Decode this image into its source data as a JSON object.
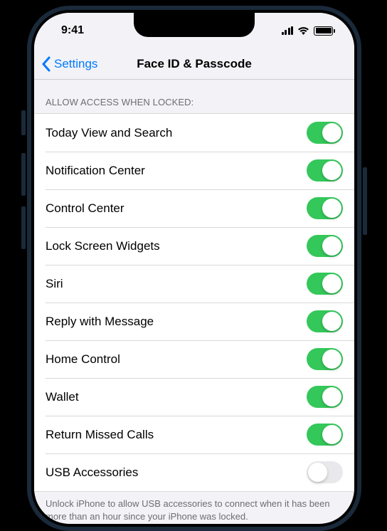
{
  "status": {
    "time": "9:41"
  },
  "nav": {
    "back_label": "Settings",
    "title": "Face ID & Passcode"
  },
  "section": {
    "header": "ALLOW ACCESS WHEN LOCKED:",
    "footer": "Unlock iPhone to allow USB accessories to connect when it has been more than an hour since your iPhone was locked."
  },
  "rows": [
    {
      "label": "Today View and Search",
      "on": true
    },
    {
      "label": "Notification Center",
      "on": true
    },
    {
      "label": "Control Center",
      "on": true
    },
    {
      "label": "Lock Screen Widgets",
      "on": true
    },
    {
      "label": "Siri",
      "on": true
    },
    {
      "label": "Reply with Message",
      "on": true
    },
    {
      "label": "Home Control",
      "on": true
    },
    {
      "label": "Wallet",
      "on": true
    },
    {
      "label": "Return Missed Calls",
      "on": true
    },
    {
      "label": "USB Accessories",
      "on": false
    }
  ]
}
